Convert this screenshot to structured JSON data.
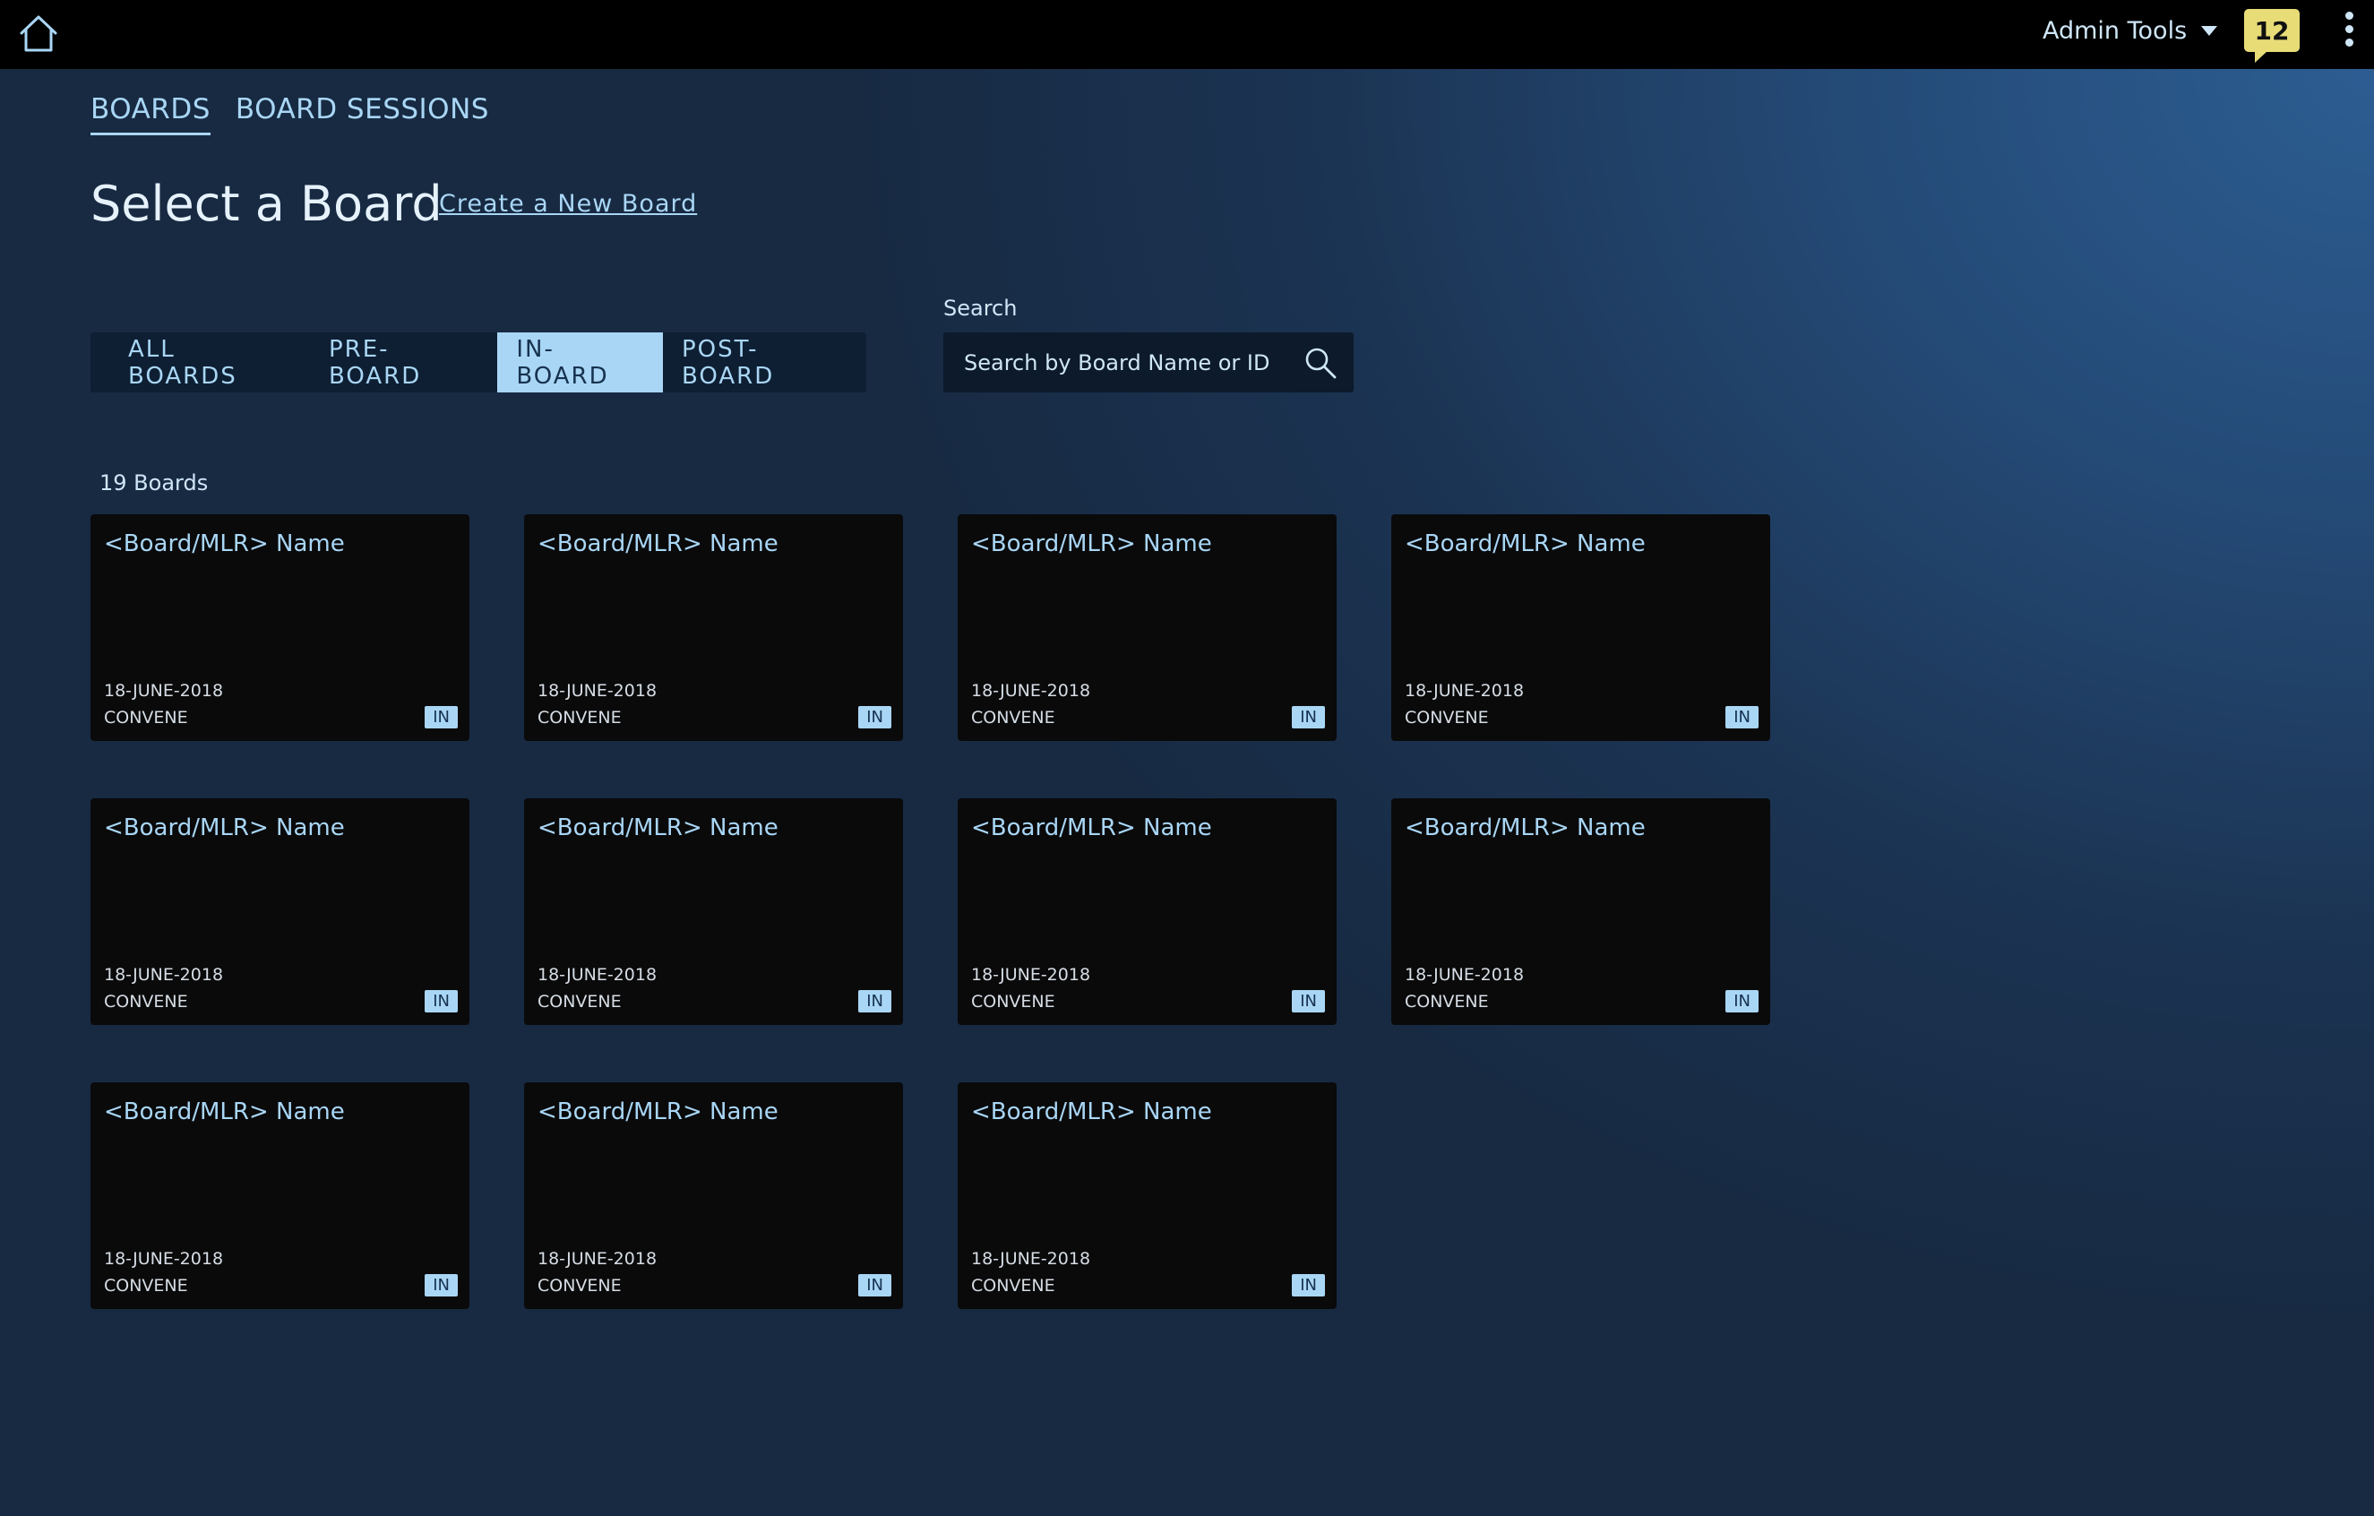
{
  "topbar": {
    "admin_label": "Admin Tools",
    "notification_count": "12"
  },
  "nav": {
    "tabs": [
      {
        "label": "BOARDS",
        "active": true
      },
      {
        "label": "BOARD SESSIONS",
        "active": false
      }
    ]
  },
  "page": {
    "title": "Select a Board",
    "create_link": "Create a New Board"
  },
  "filters": [
    {
      "label": "ALL BOARDS",
      "active": false
    },
    {
      "label": "PRE-BOARD",
      "active": false
    },
    {
      "label": "IN-BOARD",
      "active": true
    },
    {
      "label": "POST-BOARD",
      "active": false
    }
  ],
  "search": {
    "label": "Search",
    "placeholder": "Search by Board Name or ID"
  },
  "boards": {
    "count_label": "19 Boards",
    "items": [
      {
        "name": "<Board/MLR> Name",
        "date": "18-JUNE-2018",
        "org": "CONVENE",
        "status": "IN"
      },
      {
        "name": "<Board/MLR> Name",
        "date": "18-JUNE-2018",
        "org": "CONVENE",
        "status": "IN"
      },
      {
        "name": "<Board/MLR> Name",
        "date": "18-JUNE-2018",
        "org": "CONVENE",
        "status": "IN"
      },
      {
        "name": "<Board/MLR> Name",
        "date": "18-JUNE-2018",
        "org": "CONVENE",
        "status": "IN"
      },
      {
        "name": "<Board/MLR> Name",
        "date": "18-JUNE-2018",
        "org": "CONVENE",
        "status": "IN"
      },
      {
        "name": "<Board/MLR> Name",
        "date": "18-JUNE-2018",
        "org": "CONVENE",
        "status": "IN"
      },
      {
        "name": "<Board/MLR> Name",
        "date": "18-JUNE-2018",
        "org": "CONVENE",
        "status": "IN"
      },
      {
        "name": "<Board/MLR> Name",
        "date": "18-JUNE-2018",
        "org": "CONVENE",
        "status": "IN"
      },
      {
        "name": "<Board/MLR> Name",
        "date": "18-JUNE-2018",
        "org": "CONVENE",
        "status": "IN"
      },
      {
        "name": "<Board/MLR> Name",
        "date": "18-JUNE-2018",
        "org": "CONVENE",
        "status": "IN"
      },
      {
        "name": "<Board/MLR> Name",
        "date": "18-JUNE-2018",
        "org": "CONVENE",
        "status": "IN"
      }
    ]
  },
  "colors": {
    "accent": "#a9d6f5",
    "notification": "#e8dc77",
    "topbar": "#000000",
    "card": "#0a0a0b"
  },
  "icons": [
    "home-icon",
    "caret-down-icon",
    "notification-icon",
    "kebab-menu-icon",
    "search-icon"
  ]
}
